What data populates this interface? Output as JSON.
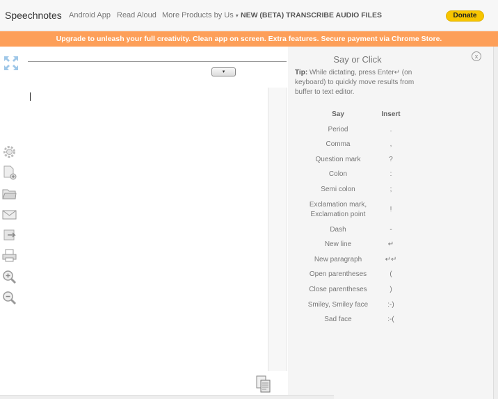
{
  "header": {
    "brand": "Speechnotes",
    "nav": [
      {
        "label": "Android App"
      },
      {
        "label": "Read Aloud"
      },
      {
        "label": "More Products by Us",
        "caret": "▾"
      },
      {
        "label": "NEW (BETA) TRANSCRIBE AUDIO FILES"
      }
    ],
    "donate_label": "Donate"
  },
  "banner": "Upgrade to unleash your full creativity. Clean app on screen. Extra features. Secure payment via Chrome Store.",
  "editor": {
    "dropdown_label": "▾",
    "content": ""
  },
  "toolbar_icons": [
    "settings-icon",
    "new-document-icon",
    "open-folder-icon",
    "email-icon",
    "export-icon",
    "print-icon",
    "zoom-in-icon",
    "zoom-out-icon"
  ],
  "panel": {
    "title": "Say or Click",
    "close_label": "x",
    "tip_label": "Tip:",
    "tip_text": " While dictating, press Enter↵ (on keyboard) to quickly move results from buffer to text editor.",
    "col_say": "Say",
    "col_insert": "Insert",
    "commands": [
      {
        "say": "Period",
        "insert": "."
      },
      {
        "say": "Comma",
        "insert": ","
      },
      {
        "say": "Question mark",
        "insert": "?"
      },
      {
        "say": "Colon",
        "insert": ":"
      },
      {
        "say": "Semi colon",
        "insert": ";"
      },
      {
        "say": "Exclamation mark, Exclamation point",
        "insert": "!"
      },
      {
        "say": "Dash",
        "insert": "-"
      },
      {
        "say": "New line",
        "insert": "↵"
      },
      {
        "say": "New paragraph",
        "insert": "↵↵"
      },
      {
        "say": "Open parentheses",
        "insert": "("
      },
      {
        "say": "Close parentheses",
        "insert": ")"
      },
      {
        "say": "Smiley, Smiley face",
        "insert": ":-)"
      },
      {
        "say": "Sad face",
        "insert": ":-("
      }
    ]
  },
  "colors": {
    "banner": "#fd9f59",
    "donate": "#f7c500"
  }
}
